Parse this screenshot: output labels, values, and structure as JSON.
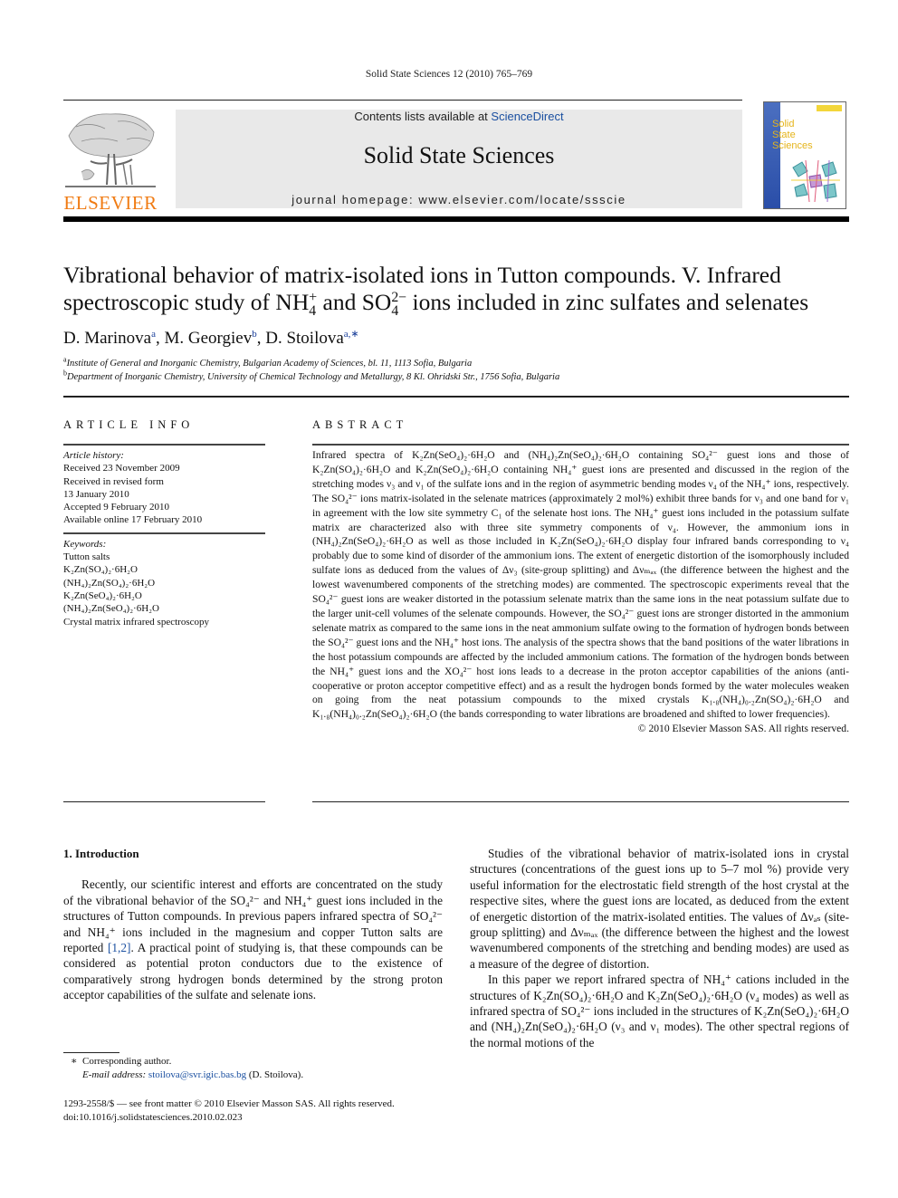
{
  "running_head": "Solid State Sciences 12 (2010) 765–769",
  "banner": {
    "contents_prefix": "Contents lists available at ",
    "contents_link": "ScienceDirect",
    "journal_title": "Solid State Sciences",
    "homepage": "journal homepage: www.elsevier.com/locate/ssscie"
  },
  "publisher_logo": {
    "wordmark": "ELSEVIER",
    "icon": "elsevier-tree-icon",
    "color": "#f07b13"
  },
  "cover": {
    "line1": "Solid",
    "line2": "State",
    "line3": "Sciences",
    "icon": "crystal-structure-icon"
  },
  "article": {
    "title_line1": "Vibrational behavior of matrix-isolated ions in Tutton compounds. V. Infrared",
    "title_line2_a": "spectroscopic study of NH",
    "title_line2_b": "and SO",
    "title_line2_c": "ions included in zinc sulfates and selenates",
    "nh4_sub": "4",
    "nh4_sup": "+",
    "so4_sub": "4",
    "so4_sup": "2−",
    "authors": [
      {
        "name": "D. Marinova",
        "marks": "a"
      },
      {
        "name": "M. Georgiev",
        "marks": "b"
      },
      {
        "name": "D. Stoilova",
        "marks": "a,∗"
      }
    ],
    "affiliations": [
      {
        "mark": "a",
        "text": "Institute of General and Inorganic Chemistry, Bulgarian Academy of Sciences, bl. 11, 1113 Sofia, Bulgaria"
      },
      {
        "mark": "b",
        "text": "Department of Inorganic Chemistry, University of Chemical Technology and Metallurgy, 8 Kl. Ohridski Str., 1756 Sofia, Bulgaria"
      }
    ]
  },
  "article_info": {
    "heading": "ARTICLE INFO",
    "history_label": "Article history:",
    "history": [
      "Received 23 November 2009",
      "Received in revised form",
      "13 January 2010",
      "Accepted 9 February 2010",
      "Available online 17 February 2010"
    ],
    "keywords_label": "Keywords:",
    "keywords": [
      "Tutton salts",
      "K₂Zn(SO₄)₂·6H₂O",
      "(NH₄)₂Zn(SO₄)₂·6H₂O",
      "K₂Zn(SeO₄)₂·6H₂O",
      "(NH₄)₂Zn(SeO₄)₂·6H₂O",
      "Crystal matrix infrared spectroscopy"
    ]
  },
  "abstract": {
    "heading": "ABSTRACT",
    "text": "Infrared spectra of K₂Zn(SeO₄)₂·6H₂O and (NH₄)₂Zn(SeO₄)₂·6H₂O containing SO₄²⁻ guest ions and those of K₂Zn(SO₄)₂·6H₂O and K₂Zn(SeO₄)₂·6H₂O containing NH₄⁺ guest ions are presented and discussed in the region of the stretching modes ν₃ and ν₁ of the sulfate ions and in the region of asymmetric bending modes ν₄ of the NH₄⁺ ions, respectively. The SO₄²⁻ ions matrix-isolated in the selenate matrices (approximately 2 mol%) exhibit three bands for ν₃ and one band for ν₁ in agreement with the low site symmetry C₁ of the selenate host ions. The NH₄⁺ guest ions included in the potassium sulfate matrix are characterized also with three site symmetry components of ν₄. However, the ammonium ions in (NH₄)₂Zn(SeO₄)₂·6H₂O as well as those included in K₂Zn(SeO₄)₂·6H₂O display four infrared bands corresponding to ν₄ probably due to some kind of disorder of the ammonium ions. The extent of energetic distortion of the isomorphously included sulfate ions as deduced from the values of Δν₃ (site-group splitting) and Δνₘₐₓ (the difference between the highest and the lowest wavenumbered components of the stretching modes) are commented. The spectroscopic experiments reveal that the SO₄²⁻ guest ions are weaker distorted in the potassium selenate matrix than the same ions in the neat potassium sulfate due to the larger unit-cell volumes of the selenate compounds. However, the SO₄²⁻ guest ions are stronger distorted in the ammonium selenate matrix as compared to the same ions in the neat ammonium sulfate owing to the formation of hydrogen bonds between the SO₄²⁻ guest ions and the NH₄⁺ host ions. The analysis of the spectra shows that the band positions of the water librations in the host potassium compounds are affected by the included ammonium cations. The formation of the hydrogen bonds between the NH₄⁺ guest ions and the XO₄²⁻ host ions leads to a decrease in the proton acceptor capabilities of the anions (anti-cooperative or proton acceptor competitive effect) and as a result the hydrogen bonds formed by the water molecules weaken on going from the neat potassium compounds to the mixed crystals K₁.₈(NH₄)₀.₂Zn(SO₄)₂·6H₂O and K₁.₈(NH₄)₀.₂Zn(SeO₄)₂·6H₂O (the bands corresponding to water librations are broadened and shifted to lower frequencies).",
    "copyright": "© 2010 Elsevier Masson SAS. All rights reserved."
  },
  "body": {
    "section1_heading": "1.  Introduction",
    "left_para_1a": "Recently, our scientific interest and efforts are concentrated on the study of the vibrational behavior of the SO₄²⁻ and NH₄⁺ guest ions included in the structures of Tutton compounds. In previous papers infrared spectra of SO₄²⁻ and NH₄⁺ ions included in the magnesium and copper Tutton salts are reported ",
    "left_para_1_ref": "[1,2]",
    "left_para_1b": ". A practical point of studying is, that these compounds can be considered as potential proton conductors due to the existence of comparatively strong hydrogen bonds determined by the strong proton acceptor capabilities of the sulfate and selenate ions.",
    "right_para_1": "Studies of the vibrational behavior of matrix-isolated ions in crystal structures (concentrations of the guest ions up to 5–7 mol %) provide very useful information for the electrostatic field strength of the host crystal at the respective sites, where the guest ions are located, as deduced from the extent of energetic distortion of the matrix-isolated entities. The values of Δνₐₛ (site-group splitting) and Δνₘₐₓ (the difference between the highest and the lowest wavenumbered components of the stretching and bending modes) are used as a measure of the degree of distortion.",
    "right_para_2": "In this paper we report infrared spectra of NH₄⁺ cations included in the structures of K₂Zn(SO₄)₂·6H₂O and K₂Zn(SeO₄)₂·6H₂O (ν₄ modes) as well as infrared spectra of SO₄²⁻ ions included in the structures of K₂Zn(SeO₄)₂·6H₂O and (NH₄)₂Zn(SeO₄)₂·6H₂O (ν₃ and ν₁ modes). The other spectral regions of the normal motions of the"
  },
  "footnote": {
    "star": "∗",
    "corresponding": "Corresponding author.",
    "email_label": "E-mail address:",
    "email": "stoilova@svr.igic.bas.bg",
    "email_suffix": " (D. Stoilova).",
    "issn_line": "1293-2558/$ — see front matter © 2010 Elsevier Masson SAS. All rights reserved.",
    "doi_line": "doi:10.1016/j.solidstatesciences.2010.02.023"
  },
  "colors": {
    "link": "#1a4fa0",
    "elsevier_orange": "#f07b13",
    "banner_bg": "#e9e9e9"
  }
}
